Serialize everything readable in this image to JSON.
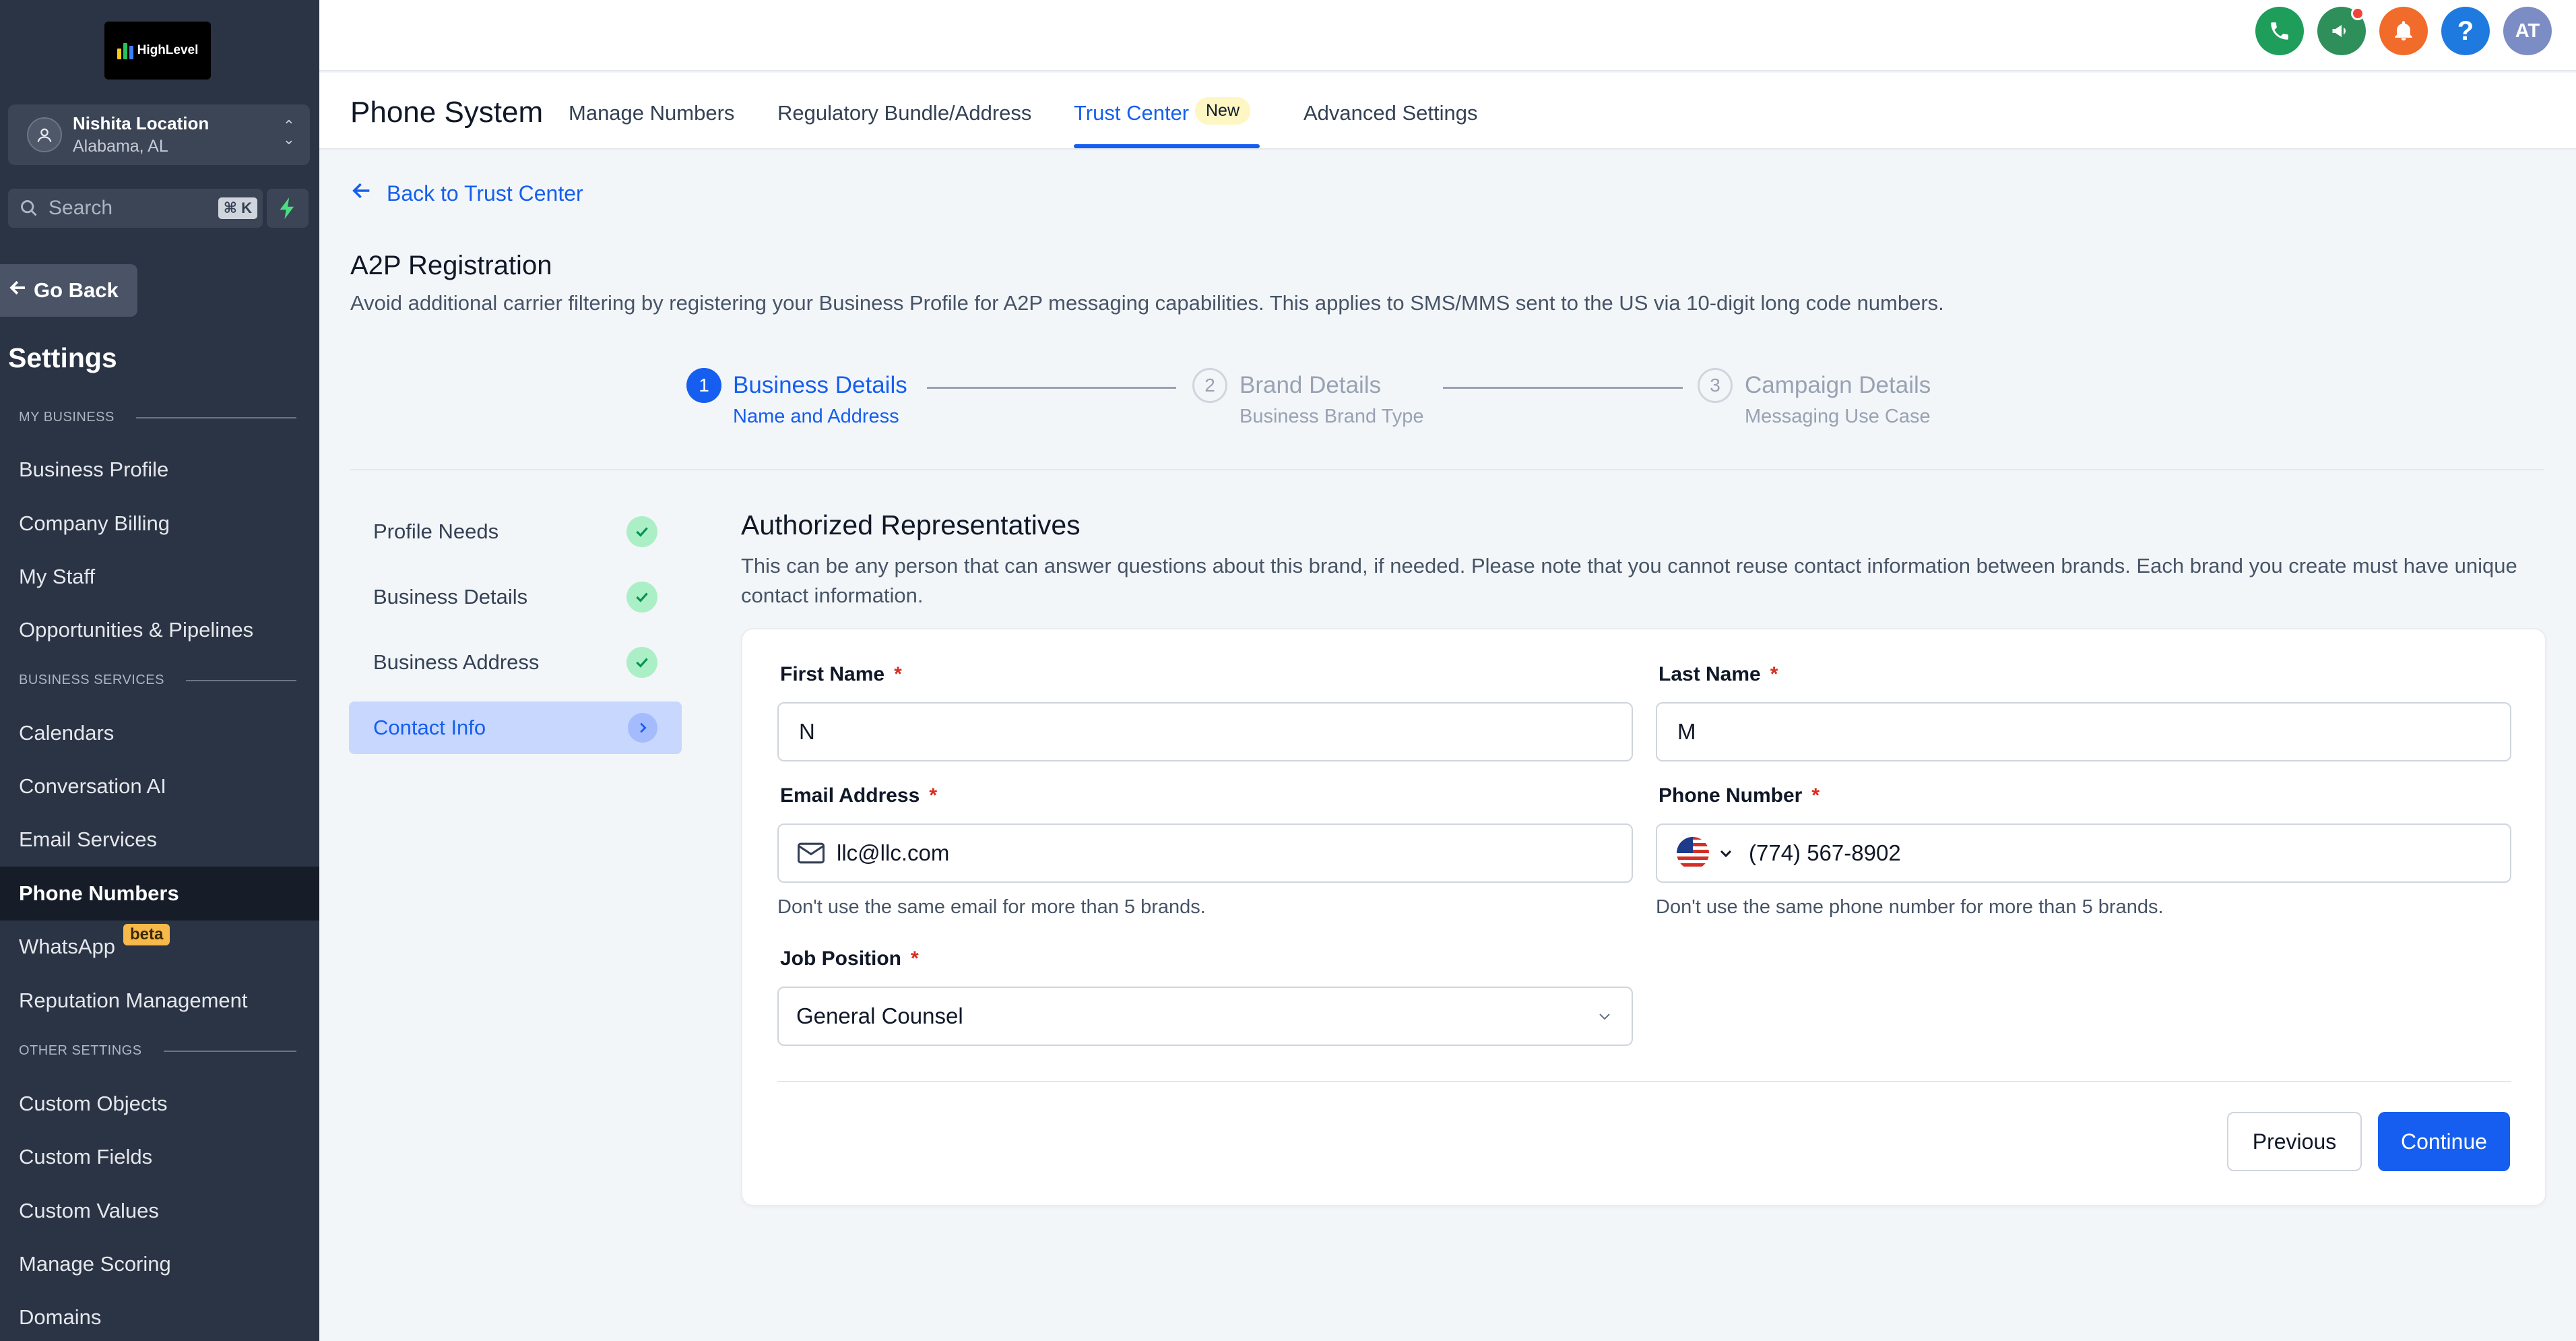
{
  "sidebar": {
    "logo_text": "HighLevel",
    "location": {
      "name": "Nishita Location",
      "sub": "Alabama, AL"
    },
    "search": {
      "placeholder": "Search",
      "shortcut": "⌘ K"
    },
    "go_back": "Go Back",
    "title": "Settings",
    "sections": {
      "my_business": "MY BUSINESS",
      "business_services": "BUSINESS SERVICES",
      "other_settings": "OTHER SETTINGS"
    },
    "items": [
      {
        "label": "Business Profile"
      },
      {
        "label": "Company Billing"
      },
      {
        "label": "My Staff"
      },
      {
        "label": "Opportunities & Pipelines"
      },
      {
        "label": "Calendars"
      },
      {
        "label": "Conversation AI"
      },
      {
        "label": "Email Services"
      },
      {
        "label": "Phone Numbers",
        "active": true
      },
      {
        "label": "WhatsApp",
        "badge": "beta"
      },
      {
        "label": "Reputation Management"
      },
      {
        "label": "Custom Objects"
      },
      {
        "label": "Custom Fields"
      },
      {
        "label": "Custom Values"
      },
      {
        "label": "Manage Scoring"
      },
      {
        "label": "Domains"
      }
    ]
  },
  "topbar": {
    "icons": [
      "phone-icon",
      "megaphone-icon",
      "bell-icon",
      "help-icon"
    ],
    "avatar_initials": "AT",
    "colors": {
      "phone": "#1e9e5a",
      "megaphone": "#2f8f5b",
      "bell": "#f16b2a",
      "help": "#1f7ae0",
      "avatar": "#7c8cc4"
    }
  },
  "subheader": {
    "title": "Phone System",
    "tabs": [
      {
        "label": "Manage Numbers"
      },
      {
        "label": "Regulatory Bundle/Address"
      },
      {
        "label": "Trust Center",
        "active": true,
        "badge": "New"
      },
      {
        "label": "Advanced Settings"
      }
    ]
  },
  "content": {
    "back_link": "Back to Trust Center",
    "title": "A2P Registration",
    "description": "Avoid additional carrier filtering by registering your Business Profile for A2P messaging capabilities. This applies to SMS/MMS sent to the US via 10-digit long code numbers.",
    "steps": [
      {
        "number": "1",
        "title": "Business Details",
        "subtitle": "Name and Address",
        "active": true
      },
      {
        "number": "2",
        "title": "Brand Details",
        "subtitle": "Business Brand Type",
        "active": false
      },
      {
        "number": "3",
        "title": "Campaign Details",
        "subtitle": "Messaging Use Case",
        "active": false
      }
    ],
    "side_steps": [
      {
        "label": "Profile Needs",
        "done": true
      },
      {
        "label": "Business Details",
        "done": true
      },
      {
        "label": "Business Address",
        "done": true
      },
      {
        "label": "Contact Info",
        "active": true
      }
    ],
    "section": {
      "title": "Authorized Representatives",
      "description": "This can be any person that can answer questions about this brand, if needed. Please note that you cannot reuse contact information between brands. Each brand you create must have unique contact information."
    },
    "form": {
      "first_name": {
        "label": "First Name",
        "value": "N"
      },
      "last_name": {
        "label": "Last Name",
        "value": "M"
      },
      "email": {
        "label": "Email Address",
        "value": "llc@llc.com",
        "hint": "Don't use the same email for more than 5 brands."
      },
      "phone": {
        "label": "Phone Number",
        "value": "(774) 567-8902",
        "hint": "Don't use the same phone number for more than 5 brands."
      },
      "job_position": {
        "label": "Job Position",
        "value": "General Counsel"
      },
      "required_marker": "*"
    },
    "buttons": {
      "previous": "Previous",
      "continue": "Continue"
    }
  },
  "colors": {
    "accent": "#155eef",
    "sidebar_bg": "#2b3444",
    "success": "#17b26a"
  }
}
